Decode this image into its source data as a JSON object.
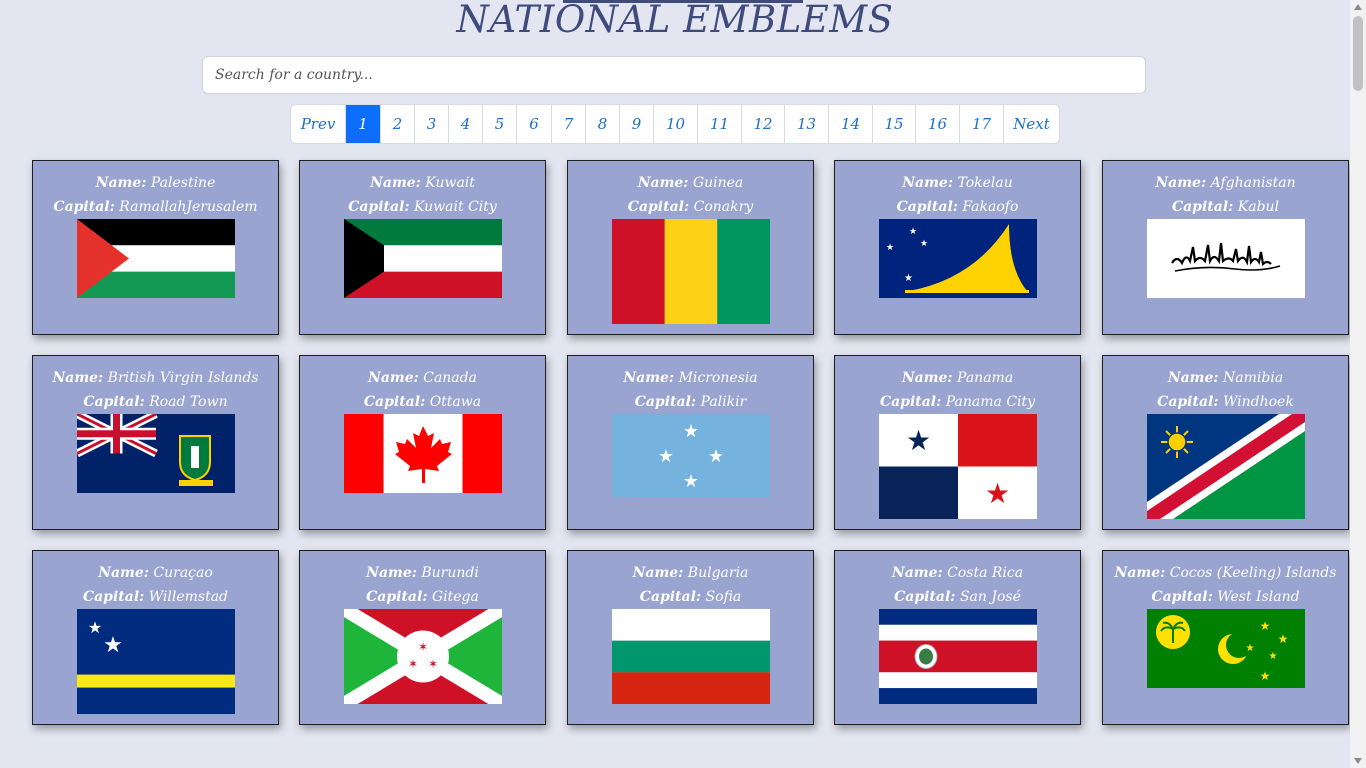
{
  "header": {
    "title": "NATIONAL EMBLEMS"
  },
  "search": {
    "placeholder": "Search for a country..."
  },
  "pagination": {
    "prev_label": "Prev",
    "next_label": "Next",
    "pages": [
      "1",
      "2",
      "3",
      "4",
      "5",
      "6",
      "7",
      "8",
      "9",
      "10",
      "11",
      "12",
      "13",
      "14",
      "15",
      "16",
      "17"
    ],
    "active_page": "1"
  },
  "labels": {
    "name": "Name:",
    "capital": "Capital:"
  },
  "countries": [
    {
      "name": "Palestine",
      "capital": "RamallahJerusalem",
      "flag": "palestine-flag"
    },
    {
      "name": "Kuwait",
      "capital": "Kuwait City",
      "flag": "kuwait-flag"
    },
    {
      "name": "Guinea",
      "capital": "Conakry",
      "flag": "guinea-flag"
    },
    {
      "name": "Tokelau",
      "capital": "Fakaofo",
      "flag": "tokelau-flag"
    },
    {
      "name": "Afghanistan",
      "capital": "Kabul",
      "flag": "afghanistan-flag"
    },
    {
      "name": "British Virgin Islands",
      "capital": "Road Town",
      "flag": "british-virgin-islands-flag"
    },
    {
      "name": "Canada",
      "capital": "Ottawa",
      "flag": "canada-flag"
    },
    {
      "name": "Micronesia",
      "capital": "Palikir",
      "flag": "micronesia-flag"
    },
    {
      "name": "Panama",
      "capital": "Panama City",
      "flag": "panama-flag"
    },
    {
      "name": "Namibia",
      "capital": "Windhoek",
      "flag": "namibia-flag"
    },
    {
      "name": "Curaçao",
      "capital": "Willemstad",
      "flag": "curacao-flag"
    },
    {
      "name": "Burundi",
      "capital": "Gitega",
      "flag": "burundi-flag"
    },
    {
      "name": "Bulgaria",
      "capital": "Sofia",
      "flag": "bulgaria-flag"
    },
    {
      "name": "Costa Rica",
      "capital": "San José",
      "flag": "costa-rica-flag"
    },
    {
      "name": "Cocos (Keeling) Islands",
      "capital": "West Island",
      "flag": "cocos-keeling-islands-flag"
    }
  ],
  "colors": {
    "background": "#e3e6f0",
    "title": "#3f4a7d",
    "card": "#9aa4d0",
    "active_page": "#0d6efd",
    "page_link": "#1a6fd0"
  }
}
